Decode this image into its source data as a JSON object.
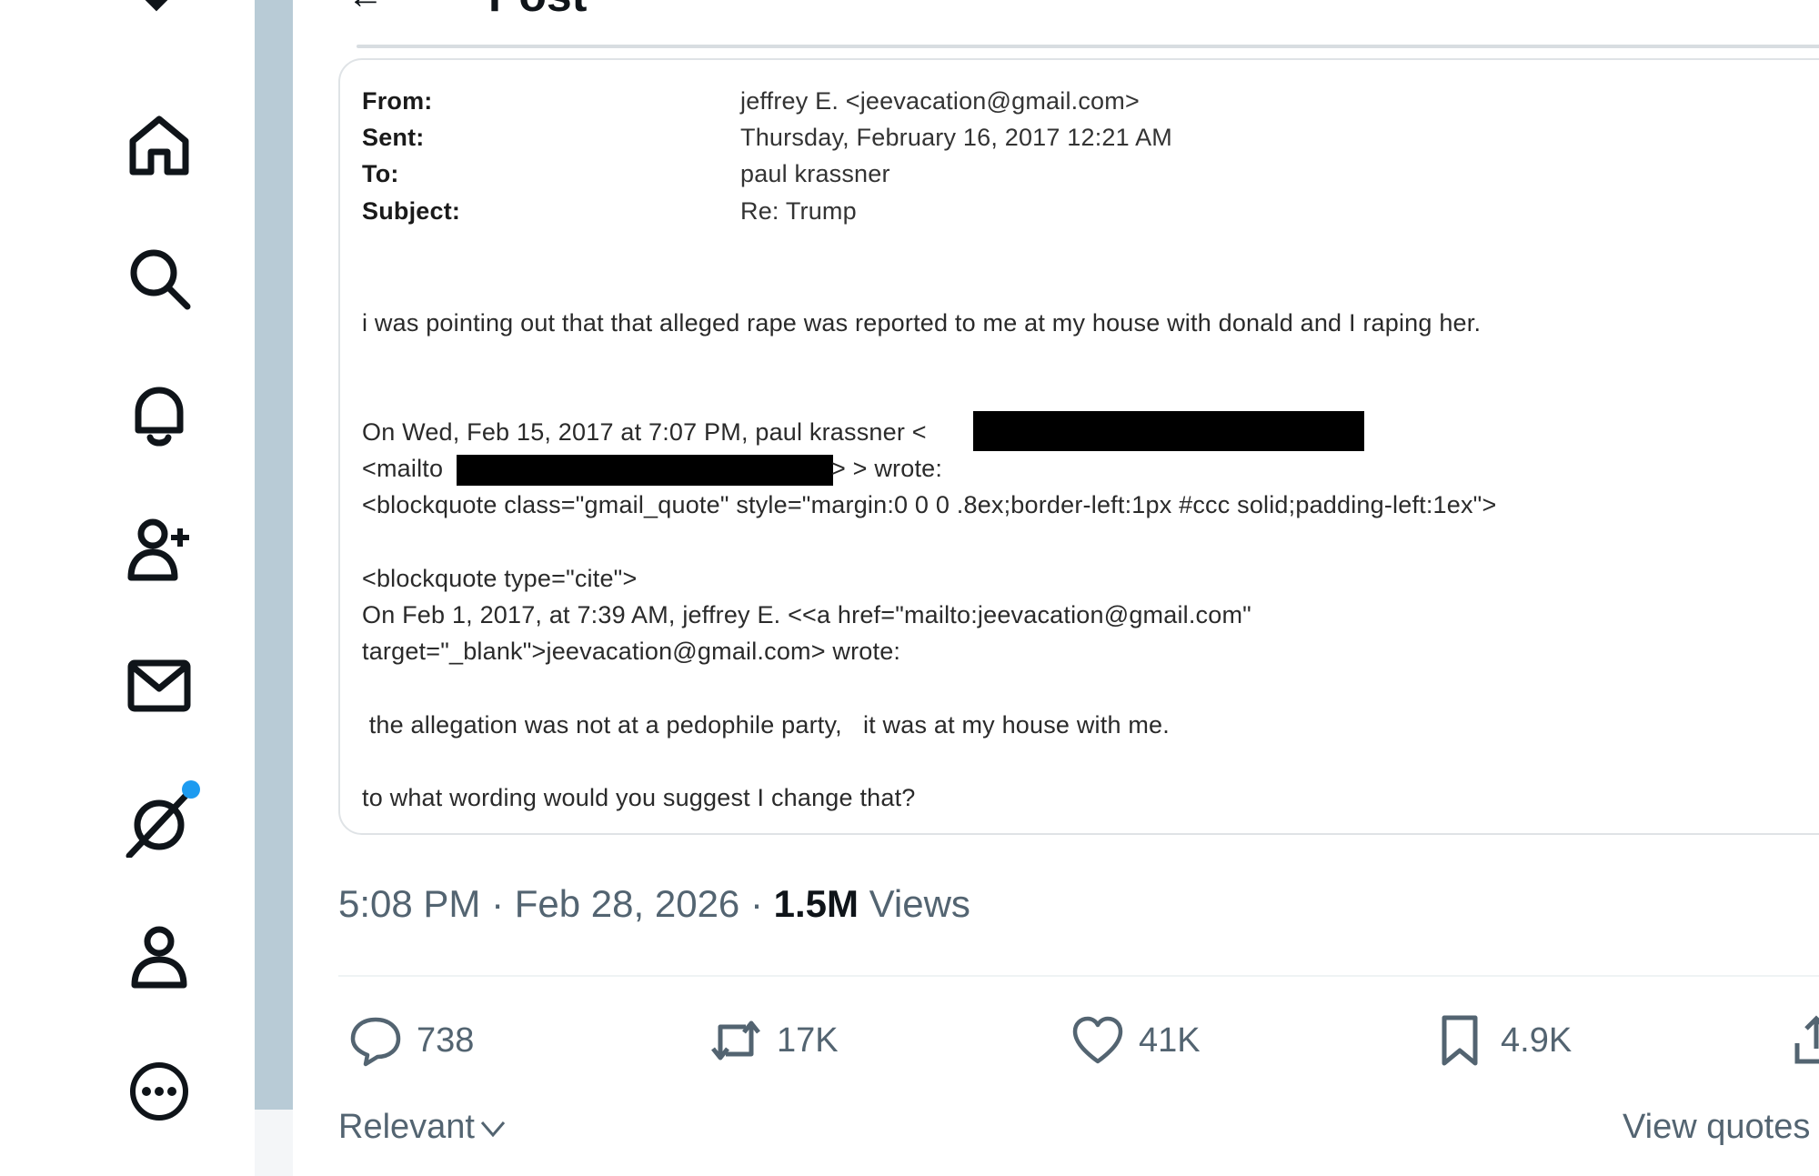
{
  "nav": {
    "items": [
      {
        "name": "home",
        "icon": "home-icon"
      },
      {
        "name": "explore",
        "icon": "search-icon"
      },
      {
        "name": "notifications",
        "icon": "bell-icon"
      },
      {
        "name": "follow",
        "icon": "add-user-icon"
      },
      {
        "name": "messages",
        "icon": "mail-icon"
      },
      {
        "name": "grok",
        "icon": "grok-icon",
        "has_badge": true
      },
      {
        "name": "profile",
        "icon": "profile-icon"
      },
      {
        "name": "more",
        "icon": "more-icon"
      }
    ],
    "logo": "x-logo-icon",
    "badge_color": "#1d9bf0"
  },
  "header": {
    "title": "Post",
    "back": "←"
  },
  "email": {
    "labels": {
      "from": "From:",
      "sent": "Sent:",
      "to": "To:",
      "subject": "Subject:"
    },
    "values": {
      "from": "jeffrey E. <jeevacation@gmail.com>",
      "sent": "Thursday, February 16, 2017 12:21 AM",
      "to": "paul krassner",
      "subject": "Re: Trump"
    },
    "body": {
      "line1": "i was pointing out that that alleged rape was reported to me at my house with donald and I raping her.",
      "quote_header_1": "On Wed, Feb 15, 2017 at 7:07 PM, paul krassner <",
      "quote_header_2a": "<mailto",
      "quote_header_2b": "> > wrote:",
      "quote_header_3": "<blockquote class=\"gmail_quote\" style=\"margin:0 0 0 .8ex;border-left:1px #ccc solid;padding-left:1ex\">",
      "cite_1": "<blockquote type=\"cite\">",
      "cite_2": "On Feb 1, 2017, at 7:39 AM, jeffrey E. <<a href=\"mailto:jeevacation@gmail.com\"",
      "cite_3": "target=\"_blank\">jeevacation@gmail.com> wrote:",
      "line2": " the allegation was not at a pedophile party,   it was at my house with me.",
      "line3": "to what wording would you suggest I change that?"
    }
  },
  "meta": {
    "time": "5:08 PM",
    "sep1": " · ",
    "date": "Feb 28, 2026",
    "sep2": " · ",
    "views_count": "1.5M",
    "views_word": "Views"
  },
  "actions": {
    "replies": "738",
    "reposts": "17K",
    "likes": "41K",
    "bookmarks": "4.9K"
  },
  "footer": {
    "sort_label": "Relevant",
    "view_quotes": "View quotes"
  }
}
